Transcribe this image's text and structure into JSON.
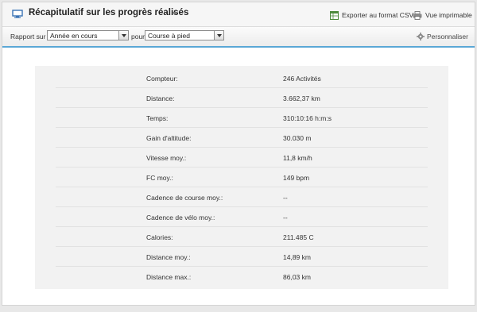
{
  "header": {
    "title": "Récapitulatif sur les progrès réalisés",
    "export_csv": "Exporter au format CSV",
    "print_view": "Vue imprimable"
  },
  "toolbar": {
    "report_label": "Rapport sur",
    "period_value": "Année en cours",
    "for_label": "pour",
    "activity_value": "Course à pied",
    "customize_label": "Personnaliser"
  },
  "stats": [
    {
      "label": "Compteur:",
      "value": "246 Activités"
    },
    {
      "label": "Distance:",
      "value": "3.662,37 km"
    },
    {
      "label": "Temps:",
      "value": "310:10:16 h:m:s"
    },
    {
      "label": "Gain d'altitude:",
      "value": "30.030 m"
    },
    {
      "label": "Vitesse moy.:",
      "value": "11,8 km/h"
    },
    {
      "label": "FC moy.:",
      "value": "149 bpm"
    },
    {
      "label": "Cadence de course moy.:",
      "value": "--"
    },
    {
      "label": "Cadence de vélo moy.:",
      "value": "--"
    },
    {
      "label": "Calories:",
      "value": "211.485 C"
    },
    {
      "label": "Distance moy.:",
      "value": "14,89 km"
    },
    {
      "label": "Distance max.:",
      "value": "86,03 km"
    }
  ],
  "icons": {
    "title": "monitor-icon",
    "title_menu": "chevron-down-icon",
    "csv": "spreadsheet-icon",
    "print": "printer-icon",
    "customize": "gear-icon"
  },
  "colors": {
    "accent": "#5aa7d6",
    "panel_bg": "#ffffff",
    "stats_bg": "#f2f2f2"
  }
}
